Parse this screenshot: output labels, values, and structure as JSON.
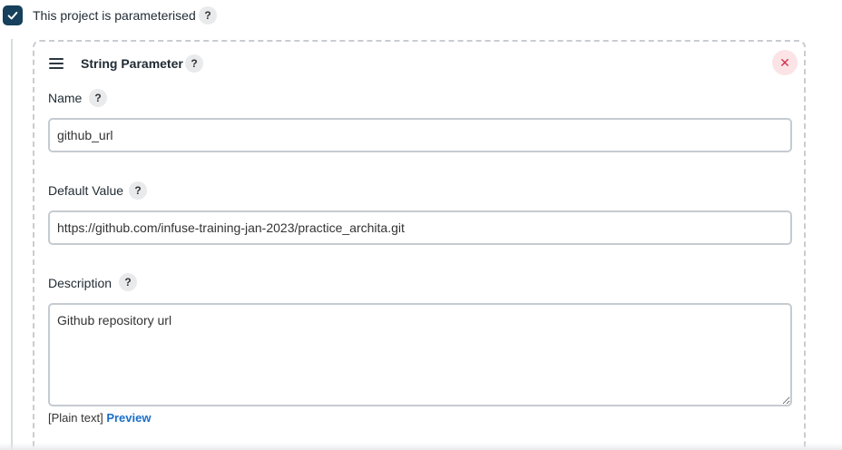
{
  "project": {
    "parameterised_label": "This project is parameterised",
    "parameterised_checked": true,
    "help_label": "?"
  },
  "parameter": {
    "type_title": "String Parameter",
    "help_label": "?",
    "close_label": "✕",
    "name": {
      "label": "Name",
      "help_label": "?",
      "value": "github_url"
    },
    "default_value": {
      "label": "Default Value",
      "help_label": "?",
      "value": "https://github.com/infuse-training-jan-2023/practice_archita.git"
    },
    "description": {
      "label": "Description",
      "help_label": "?",
      "value": "Github repository url",
      "markup_label": "[Plain text]",
      "preview_label": "Preview"
    }
  },
  "colors": {
    "checkbox_bg": "#16405b",
    "close_bg": "#fbe3e6",
    "close_fg": "#d32f4b",
    "link": "#1a6fc9"
  },
  "icons": {
    "checkbox": "check-icon",
    "drag": "drag-handle-icon",
    "close": "close-icon",
    "help": "question-mark-icon"
  }
}
